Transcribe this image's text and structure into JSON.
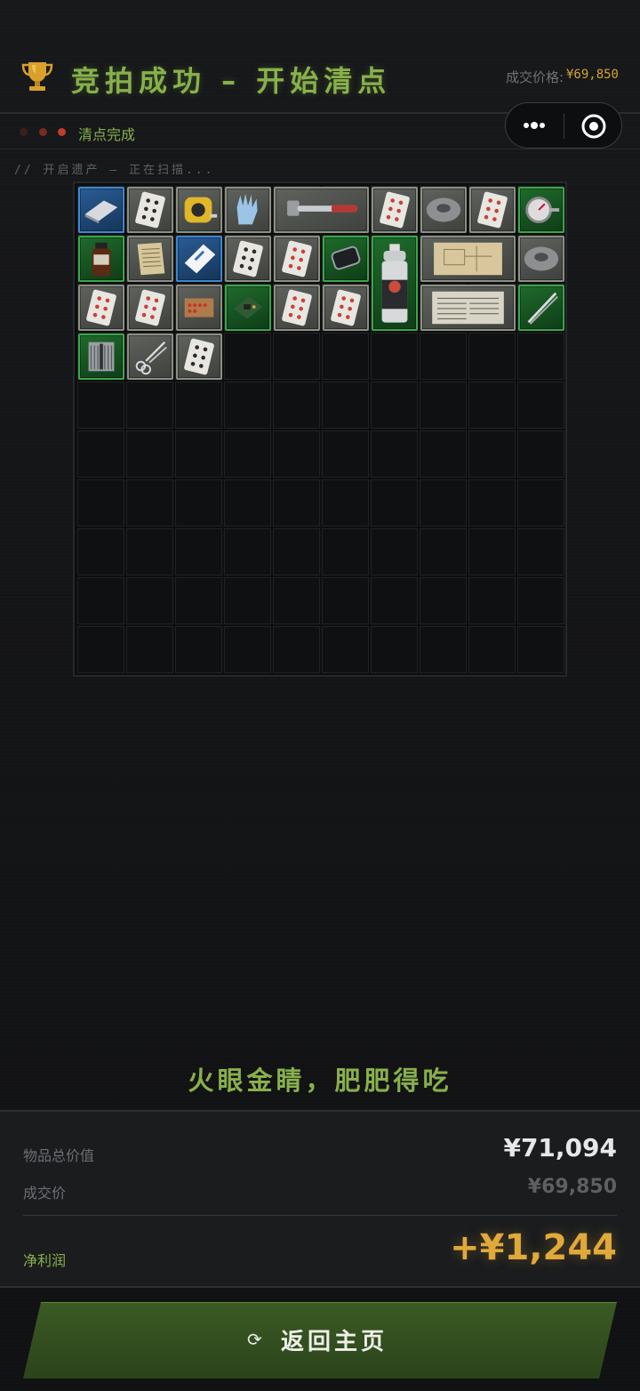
{
  "header": {
    "title": "竞拍成功 – 开始清点",
    "price_label": "成交价格:",
    "price_value": "¥69,850"
  },
  "status": {
    "text": "清点完成"
  },
  "scan": {
    "text": "// 开启遗产 – 正在扫描..."
  },
  "grid": {
    "columns": 10,
    "rows": 10,
    "items": [
      {
        "name": "metal-plate",
        "tier": "blue",
        "icon": "metal-plate-icon"
      },
      {
        "name": "playing-card-spades",
        "tier": "gray",
        "icon": "card-icon"
      },
      {
        "name": "tape-measure",
        "tier": "gray",
        "icon": "tape-measure-icon"
      },
      {
        "name": "rubber-gloves",
        "tier": "gray",
        "icon": "glove-icon"
      },
      {
        "name": "hammer",
        "tier": "gray",
        "icon": "hammer-icon"
      },
      {
        "name": "playing-card-hearts",
        "tier": "gray",
        "icon": "card-icon"
      },
      {
        "name": "duct-tape",
        "tier": "gray",
        "icon": "tape-roll-icon"
      },
      {
        "name": "playing-card-hearts",
        "tier": "gray",
        "icon": "card-icon"
      },
      {
        "name": "thermometer-gauge",
        "tier": "green",
        "icon": "gauge-icon"
      },
      {
        "name": "medicine-bottle",
        "tier": "green",
        "icon": "bottle-icon"
      },
      {
        "name": "old-document",
        "tier": "gray",
        "icon": "document-icon"
      },
      {
        "name": "battery-pack",
        "tier": "blue",
        "icon": "battery-pack-icon"
      },
      {
        "name": "playing-card-spades",
        "tier": "gray",
        "icon": "card-icon"
      },
      {
        "name": "playing-card-hearts",
        "tier": "gray",
        "icon": "card-icon"
      },
      {
        "name": "phone-pad",
        "tier": "green",
        "icon": "phone-icon"
      },
      {
        "name": "spray-can",
        "tier": "green",
        "icon": "spray-can-icon"
      },
      {
        "name": "blueprint-map",
        "tier": "gray",
        "icon": "map-icon"
      },
      {
        "name": "electrical-tape",
        "tier": "gray",
        "icon": "tape-roll-icon"
      },
      {
        "name": "playing-card-hearts",
        "tier": "gray",
        "icon": "card-icon"
      },
      {
        "name": "playing-card-hearts",
        "tier": "gray",
        "icon": "card-icon"
      },
      {
        "name": "matchbox",
        "tier": "gray",
        "icon": "matchbox-icon"
      },
      {
        "name": "circuit-board",
        "tier": "green",
        "icon": "circuit-icon"
      },
      {
        "name": "playing-card-hearts",
        "tier": "gray",
        "icon": "card-icon"
      },
      {
        "name": "playing-card-hearts",
        "tier": "gray",
        "icon": "card-icon"
      },
      {
        "name": "newspaper",
        "tier": "gray",
        "icon": "newspaper-icon"
      },
      {
        "name": "tweezers",
        "tier": "green",
        "icon": "tweezers-icon"
      },
      {
        "name": "cpu-cooler",
        "tier": "green",
        "icon": "cooler-icon"
      },
      {
        "name": "scissors",
        "tier": "gray",
        "icon": "scissors-icon"
      },
      {
        "name": "playing-card-spades",
        "tier": "gray",
        "icon": "card-icon"
      }
    ]
  },
  "slogan": "火眼金睛，肥肥得吃",
  "summary": {
    "total_label": "物品总价值",
    "total_value": "¥71,094",
    "deal_label": "成交价",
    "deal_value": "¥69,850",
    "profit_label": "净利润",
    "profit_value": "+¥1,244"
  },
  "home_button": {
    "label": "返回主页",
    "icon": "refresh-icon"
  },
  "colors": {
    "accent_green": "#88b04b",
    "gold": "#e0a93a",
    "tier_green": "#3da54a",
    "tier_blue": "#3f86d1",
    "tier_gray": "#8d8f84"
  }
}
